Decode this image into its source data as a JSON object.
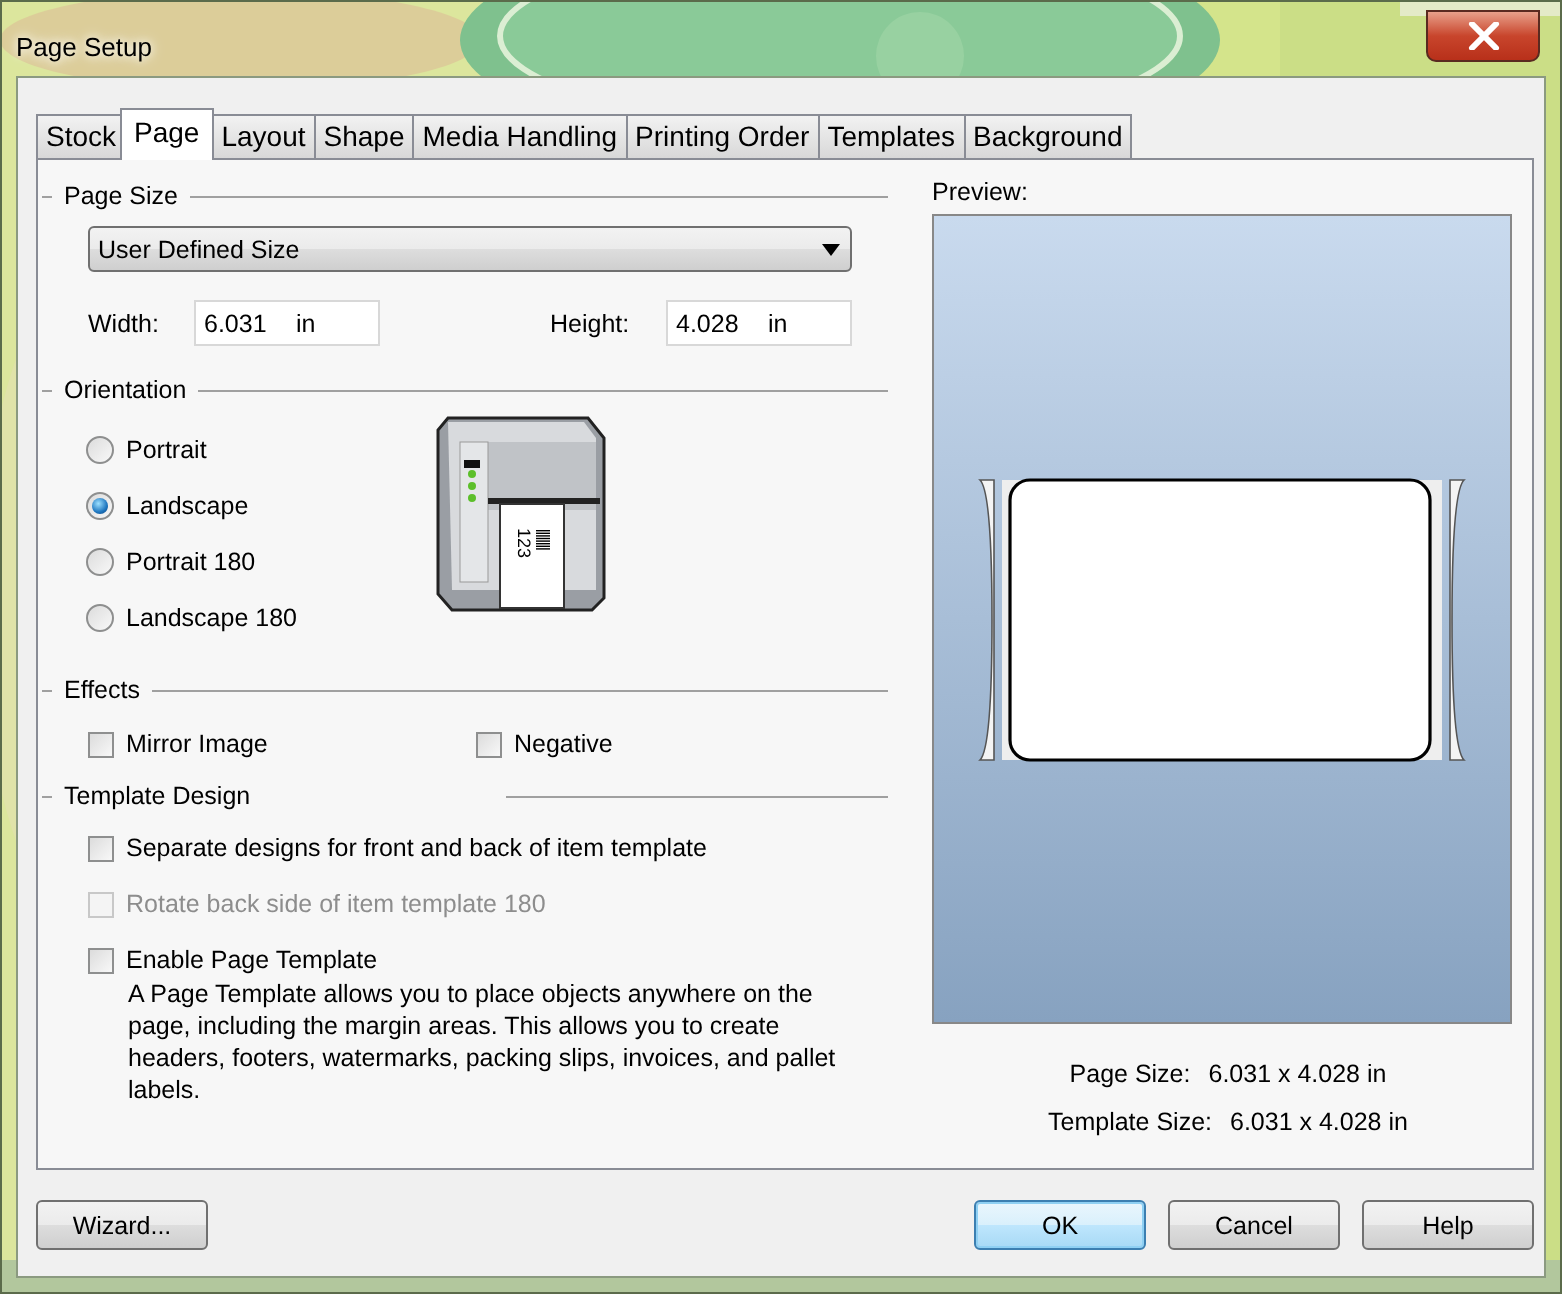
{
  "window": {
    "title": "Page Setup"
  },
  "tabs": [
    {
      "label": "Stock",
      "selected": false
    },
    {
      "label": "Page",
      "selected": true
    },
    {
      "label": "Layout",
      "selected": false
    },
    {
      "label": "Shape",
      "selected": false
    },
    {
      "label": "Media Handling",
      "selected": false
    },
    {
      "label": "Printing Order",
      "selected": false
    },
    {
      "label": "Templates",
      "selected": false
    },
    {
      "label": "Background",
      "selected": false
    }
  ],
  "page_size": {
    "heading": "Page Size",
    "dropdown": "User Defined Size",
    "width": {
      "label": "Width:",
      "value": "6.031",
      "unit": "in"
    },
    "height": {
      "label": "Height:",
      "value": "4.028",
      "unit": "in"
    }
  },
  "orientation": {
    "heading": "Orientation",
    "printer_label": "123",
    "options": [
      {
        "label": "Portrait",
        "selected": false
      },
      {
        "label": "Landscape",
        "selected": true
      },
      {
        "label": "Portrait 180",
        "selected": false
      },
      {
        "label": "Landscape 180",
        "selected": false
      }
    ]
  },
  "effects": {
    "heading": "Effects",
    "options": [
      {
        "label": "Mirror Image",
        "checked": false
      },
      {
        "label": "Negative",
        "checked": false
      }
    ]
  },
  "template_design": {
    "heading": "Template Design",
    "options": [
      {
        "label": "Separate designs for front and back of item template",
        "checked": false,
        "disabled": false
      },
      {
        "label": "Rotate back side of item template 180",
        "checked": false,
        "disabled": true
      },
      {
        "label": "Enable Page Template",
        "checked": false,
        "disabled": false
      }
    ],
    "description": "A Page Template allows you to place objects anywhere on the page, including the margin areas. This allows you to create headers, footers, watermarks, packing slips, invoices, and pallet labels."
  },
  "preview": {
    "label": "Preview:",
    "page_size": {
      "label": "Page Size:",
      "value": "6.031 x 4.028 in"
    },
    "template_size": {
      "label": "Template Size:",
      "value": "6.031 x 4.028 in"
    }
  },
  "buttons": [
    {
      "label": "Wizard...",
      "kind": "normal"
    },
    {
      "label": "OK",
      "kind": "default"
    },
    {
      "label": "Cancel",
      "kind": "normal"
    },
    {
      "label": "Help",
      "kind": "normal"
    }
  ]
}
